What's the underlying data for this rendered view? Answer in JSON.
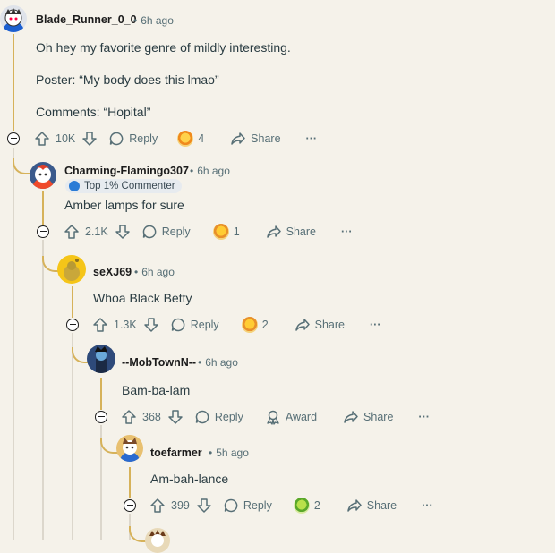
{
  "comments": [
    {
      "author": "Blade_Runner_0_0",
      "time": "6h ago",
      "lines": [
        "Oh hey my favorite genre of mildly interesting.",
        "Poster: “My body does this lmao”",
        "Comments: “Hopital”"
      ],
      "votes": "10K",
      "reply_label": "Reply",
      "award_count": "4",
      "share_label": "Share",
      "more_label": "···"
    },
    {
      "author": "Charming-Flamingo307",
      "time": "6h ago",
      "flair": "Top 1% Commenter",
      "lines": [
        "Amber lamps for sure"
      ],
      "votes": "2.1K",
      "reply_label": "Reply",
      "award_count": "1",
      "share_label": "Share",
      "more_label": "···"
    },
    {
      "author": "seXJ69",
      "time": "6h ago",
      "lines": [
        "Whoa Black Betty"
      ],
      "votes": "1.3K",
      "reply_label": "Reply",
      "award_count": "2",
      "share_label": "Share",
      "more_label": "···"
    },
    {
      "author": "--MobTownN--",
      "time": "6h ago",
      "lines": [
        "Bam-ba-lam"
      ],
      "votes": "368",
      "reply_label": "Reply",
      "award_label": "Award",
      "share_label": "Share",
      "more_label": "···"
    },
    {
      "author": "toefarmer",
      "time": "5h ago",
      "lines": [
        "Am-bah-lance"
      ],
      "votes": "399",
      "reply_label": "Reply",
      "award_count": "2",
      "share_label": "Share",
      "more_label": "···"
    }
  ],
  "icons": {
    "upvote": "upvote-icon",
    "downvote": "downvote-icon",
    "reply": "reply-icon",
    "share": "share-icon",
    "award": "award-icon",
    "collapse": "collapse-icon"
  },
  "colors": {
    "thread_line": "#d6b25a",
    "background": "#f5f2ea",
    "meta": "#576f76"
  }
}
